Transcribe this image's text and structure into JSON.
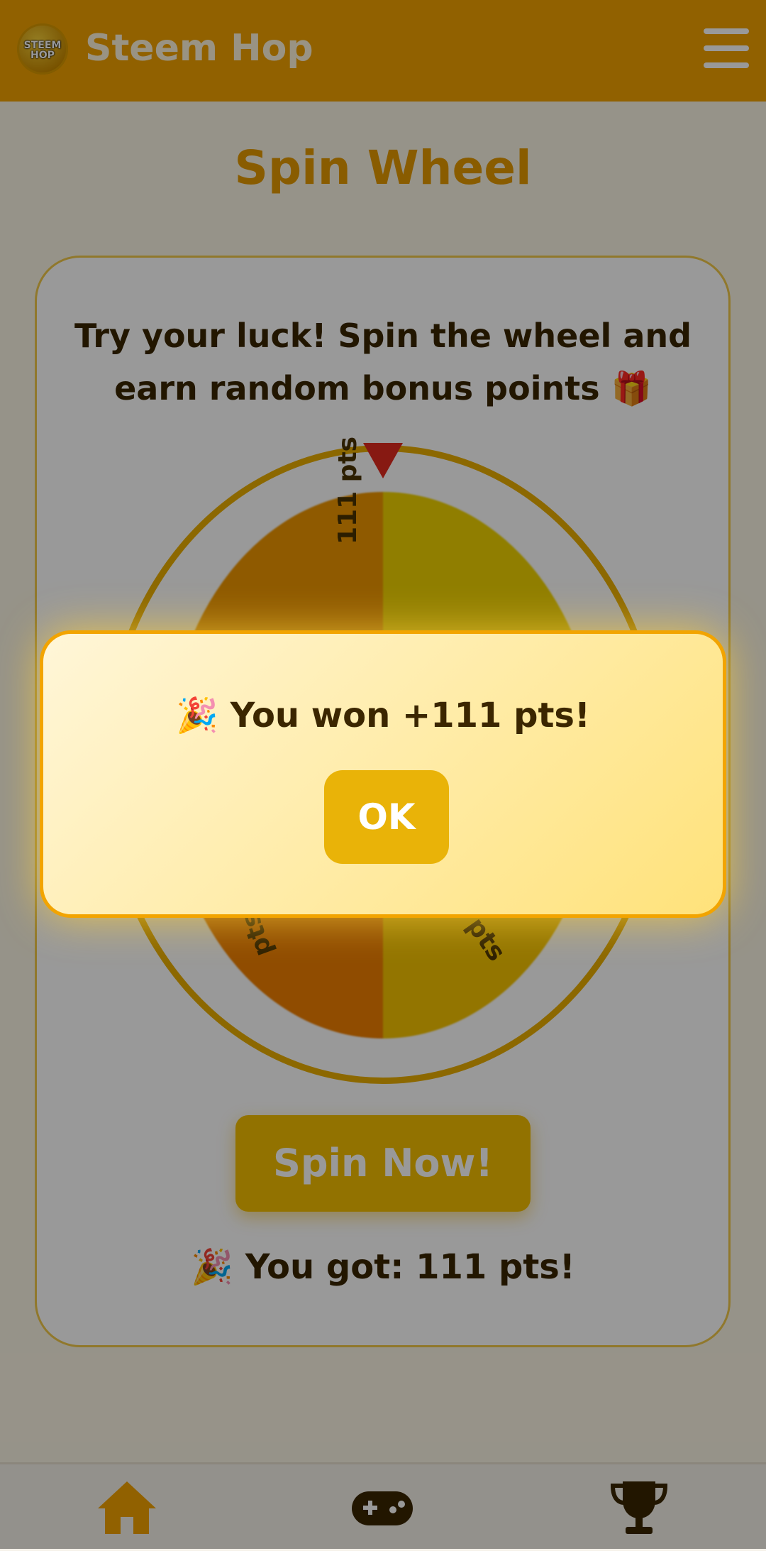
{
  "header": {
    "title": "Steem Hop",
    "logo_text": "STEEM HOP",
    "menu_icon": "hamburger-menu-icon"
  },
  "page": {
    "title": "Spin Wheel",
    "intro": "Try your luck! Spin the wheel and earn random bonus points 🎁"
  },
  "wheel": {
    "segments": [
      "111 pts",
      "pts",
      "pts"
    ],
    "pointer_icon": "triangle-pointer-icon"
  },
  "spin_button": "Spin Now!",
  "result_text": "🎉 You got: 111 pts!",
  "modal": {
    "message": "🎉 You won +111 pts!",
    "ok_label": "OK"
  },
  "bottom_nav": [
    {
      "name": "home",
      "icon": "home-icon"
    },
    {
      "name": "games",
      "icon": "gamepad-icon"
    },
    {
      "name": "leaderboard",
      "icon": "trophy-icon"
    }
  ],
  "colors": {
    "brand": "#f2a200",
    "accent": "#f3bf00",
    "text_dark": "#3a2600"
  }
}
